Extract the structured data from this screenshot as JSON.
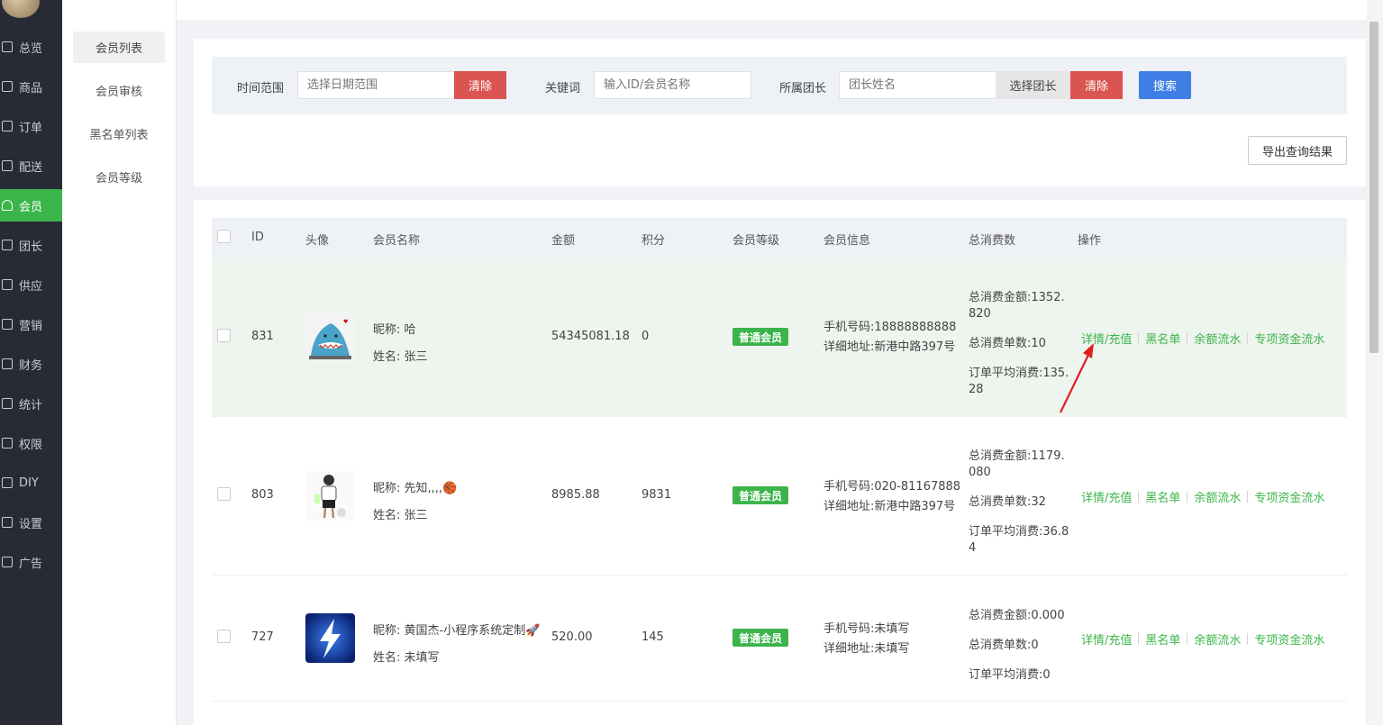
{
  "nav": {
    "items": [
      {
        "label": "总览",
        "icon": "home-icon",
        "active": false
      },
      {
        "label": "商品",
        "icon": "goods-icon",
        "active": false
      },
      {
        "label": "订单",
        "icon": "order-icon",
        "active": false
      },
      {
        "label": "配送",
        "icon": "delivery-icon",
        "active": false
      },
      {
        "label": "会员",
        "icon": "user-icon",
        "active": true
      },
      {
        "label": "团长",
        "icon": "leader-icon",
        "active": false
      },
      {
        "label": "供应",
        "icon": "supply-icon",
        "active": false
      },
      {
        "label": "营销",
        "icon": "gift-icon",
        "active": false
      },
      {
        "label": "财务",
        "icon": "finance-icon",
        "active": false
      },
      {
        "label": "统计",
        "icon": "stats-icon",
        "active": false
      },
      {
        "label": "权限",
        "icon": "shield-icon",
        "active": false
      },
      {
        "label": "DIY",
        "icon": "diy-icon",
        "active": false
      },
      {
        "label": "设置",
        "icon": "gear-icon",
        "active": false
      },
      {
        "label": "广告",
        "icon": "ad-icon",
        "active": false
      }
    ]
  },
  "subnav": {
    "items": [
      "会员列表",
      "会员审核",
      "黑名单列表",
      "会员等级"
    ]
  },
  "filter": {
    "time_label": "时间范围",
    "time_placeholder": "选择日期范围",
    "clear_label": "清除",
    "keyword_label": "关键词",
    "keyword_placeholder": "输入ID/会员名称",
    "leader_label": "所属团长",
    "leader_placeholder": "团长姓名",
    "select_leader_label": "选择团长",
    "search_label": "搜索",
    "export_label": "导出查询结果"
  },
  "table": {
    "headers": {
      "id": "ID",
      "avatar": "头像",
      "name": "会员名称",
      "amount": "金额",
      "points": "积分",
      "level": "会员等级",
      "info": "会员信息",
      "consume": "总消费数",
      "actions": "操作"
    },
    "action_labels": [
      "详情/充值",
      "黑名单",
      "余额流水",
      "专项资金流水"
    ],
    "rows": [
      {
        "id": "831",
        "nickname": "昵称: 哈",
        "realname": "姓名: 张三",
        "amount": "54345081.18",
        "points": "0",
        "level": "普通会员",
        "phone": "手机号码:18888888888",
        "address": "详细地址:新港中路397号",
        "total_amount": "总消费金额:1352.820",
        "total_count": "总消费单数:10",
        "avg": "订单平均消费:135.28"
      },
      {
        "id": "803",
        "nickname": "昵称: 先知,,,,🏀",
        "realname": "姓名: 张三",
        "amount": "8985.88",
        "points": "9831",
        "level": "普通会员",
        "phone": "手机号码:020-81167888",
        "address": "详细地址:新港中路397号",
        "total_amount": "总消费金额:1179.080",
        "total_count": "总消费单数:32",
        "avg": "订单平均消费:36.84"
      },
      {
        "id": "727",
        "nickname": "昵称: 黄国杰-小程序系统定制🚀",
        "realname": "姓名: 未填写",
        "amount": "520.00",
        "points": "145",
        "level": "普通会员",
        "phone": "手机号码:未填写",
        "address": "详细地址:未填写",
        "total_amount": "总消费金额:0.000",
        "total_count": "总消费单数:0",
        "avg": "订单平均消费:0"
      }
    ]
  },
  "colors": {
    "accent_green": "#3bb54a",
    "danger_red": "#da5451",
    "primary_blue": "#3f7fe5",
    "annotation_red": "#e02020"
  }
}
